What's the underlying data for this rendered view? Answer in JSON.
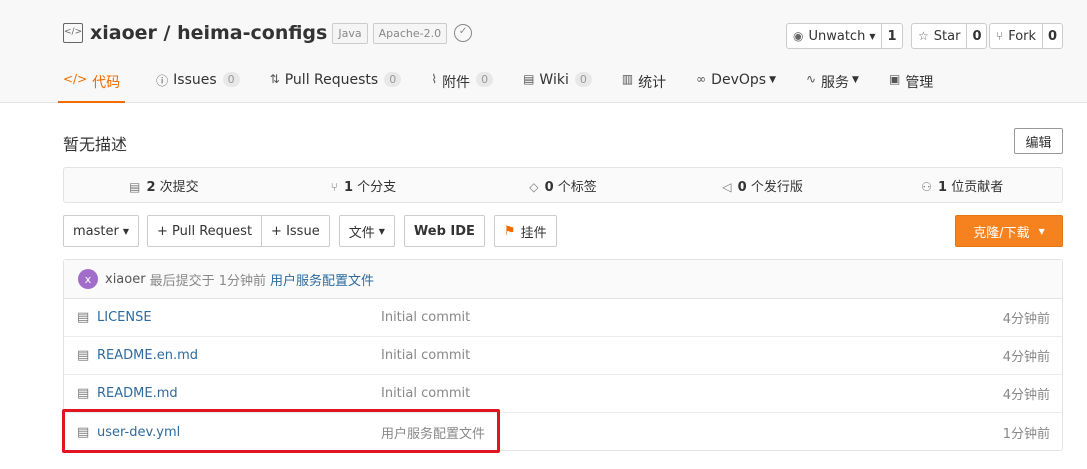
{
  "repo": {
    "title": "xiaoer / heima-configs",
    "language_tag": "Java",
    "license_tag": "Apache-2.0",
    "icon": "repo-code-icon"
  },
  "social": {
    "watch": {
      "label": "Unwatch",
      "count": "1"
    },
    "star": {
      "label": "Star",
      "count": "0"
    },
    "fork": {
      "label": "Fork",
      "count": "0"
    }
  },
  "nav": {
    "code": "代码",
    "issues": {
      "label": "Issues",
      "count": "0"
    },
    "pulls": {
      "label": "Pull Requests",
      "count": "0"
    },
    "attachments": {
      "label": "附件",
      "count": "0"
    },
    "wiki": {
      "label": "Wiki",
      "count": "0"
    },
    "stats": "统计",
    "devops": "DevOps",
    "services": "服务",
    "manage": "管理"
  },
  "description": "暂无描述",
  "edit_label": "编辑",
  "stats": {
    "commits": {
      "count": "2",
      "label": "次提交"
    },
    "branches": {
      "count": "1",
      "label": "个分支"
    },
    "tags": {
      "count": "0",
      "label": "个标签"
    },
    "releases": {
      "count": "0",
      "label": "个发行版"
    },
    "contributors": {
      "count": "1",
      "label": "位贡献者"
    }
  },
  "toolbar": {
    "branch": "master",
    "pull_request": "+ Pull Request",
    "issue": "+ Issue",
    "file": "文件",
    "web_ide": "Web IDE",
    "widget": "挂件",
    "clone": "克隆/下载"
  },
  "last_commit": {
    "avatar_letter": "x",
    "user": "xiaoer",
    "meta": "最后提交于 1分钟前",
    "message": "用户服务配置文件"
  },
  "files": [
    {
      "name": "LICENSE",
      "message": "Initial commit",
      "time": "4分钟前"
    },
    {
      "name": "README.en.md",
      "message": "Initial commit",
      "time": "4分钟前"
    },
    {
      "name": "README.md",
      "message": "Initial commit",
      "time": "4分钟前"
    },
    {
      "name": "user-dev.yml",
      "message": "用户服务配置文件",
      "time": "1分钟前"
    }
  ],
  "colors": {
    "accent": "#f06b00",
    "clone_button": "#f5821f",
    "highlight_box": "#e0151f",
    "link": "#2d6b9e",
    "avatar": "#a26dc8"
  }
}
